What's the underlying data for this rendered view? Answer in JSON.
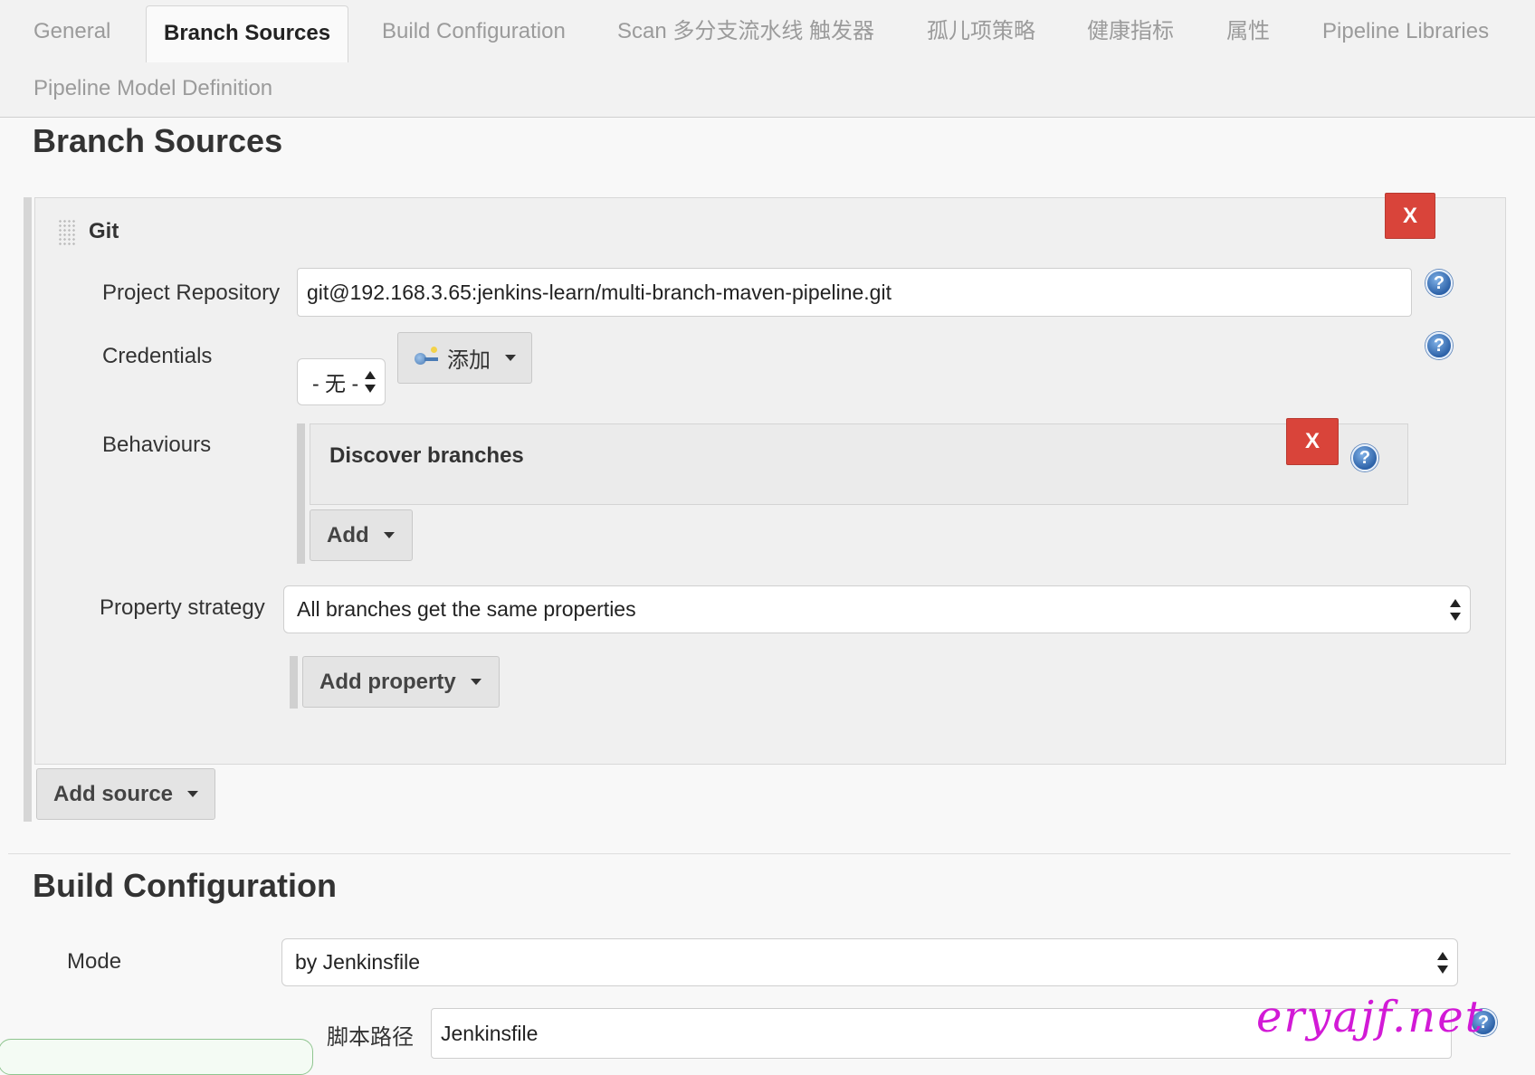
{
  "tabs": [
    {
      "label": "General"
    },
    {
      "label": "Branch Sources"
    },
    {
      "label": "Build Configuration"
    },
    {
      "label": "Scan 多分支流水线 触发器"
    },
    {
      "label": "孤儿项策略"
    },
    {
      "label": "健康指标"
    },
    {
      "label": "属性"
    },
    {
      "label": "Pipeline Libraries"
    },
    {
      "label": "Pipeline Model Definition"
    }
  ],
  "active_tab": "Branch Sources",
  "branch_sources": {
    "title": "Branch Sources",
    "source": {
      "type_label": "Git",
      "delete_label": "X",
      "project_repository": {
        "label": "Project Repository",
        "value": "git@192.168.3.65:jenkins-learn/multi-branch-maven-pipeline.git"
      },
      "credentials": {
        "label": "Credentials",
        "selected": "- 无 -",
        "add_label": "添加"
      },
      "behaviours": {
        "label": "Behaviours",
        "items": [
          {
            "title": "Discover branches",
            "delete_label": "X"
          }
        ],
        "add_label": "Add"
      },
      "property_strategy": {
        "label": "Property strategy",
        "selected": "All branches get the same properties",
        "add_property_label": "Add property"
      }
    },
    "add_source_label": "Add source"
  },
  "build_configuration": {
    "title": "Build Configuration",
    "mode": {
      "label": "Mode",
      "selected": "by Jenkinsfile"
    },
    "script_path": {
      "label": "脚本路径",
      "value": "Jenkinsfile"
    }
  },
  "help_symbol": "?",
  "watermark": "eryajf.net",
  "colors": {
    "delete_button": "#d9443a",
    "help_icon": "#2d62a8",
    "watermark": "#d21ad6"
  }
}
